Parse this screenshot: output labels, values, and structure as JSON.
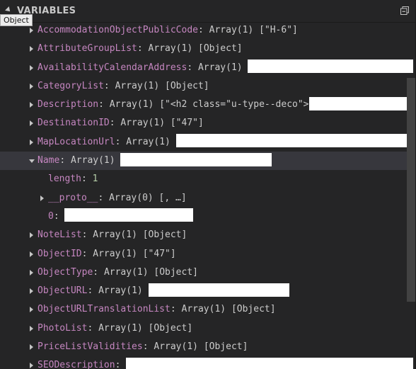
{
  "panel": {
    "title": "VARIABLES",
    "collapse_icon": "collapse-all-icon"
  },
  "tooltip": {
    "text": "Object"
  },
  "tree": {
    "rows": [
      {
        "key": "AccommodationObjectPublicCode",
        "sep": ": ",
        "value": "Array(1) [\"H-6\"]",
        "expandable": true,
        "expanded": false,
        "redacted": false
      },
      {
        "key": "AttributeGroupList",
        "sep": ": ",
        "value": "Array(1) [Object]",
        "expandable": true,
        "expanded": false,
        "redacted": false
      },
      {
        "key": "AvailabilityCalendarAddress",
        "sep": ": ",
        "value": "Array(1) ",
        "expandable": true,
        "expanded": false,
        "redacted": true
      },
      {
        "key": "CategoryList",
        "sep": ": ",
        "value": "Array(1) [Object]",
        "expandable": true,
        "expanded": false,
        "redacted": false
      },
      {
        "key": "Description",
        "sep": ": ",
        "value": "Array(1) [\"<h2 class=\"u-type--deco\">",
        "expandable": true,
        "expanded": false,
        "redacted": true
      },
      {
        "key": "DestinationID",
        "sep": ": ",
        "value": "Array(1) [\"47\"]",
        "expandable": true,
        "expanded": false,
        "redacted": false
      },
      {
        "key": "MapLocationUrl",
        "sep": ": ",
        "value": "Array(1) ",
        "expandable": true,
        "expanded": false,
        "redacted": true
      },
      {
        "key": "Name",
        "sep": ": ",
        "value": "Array(1) ",
        "expandable": true,
        "expanded": true,
        "redacted": true
      },
      {
        "key": "length",
        "sep": ": ",
        "value": "1",
        "expandable": false,
        "child": true,
        "redacted": false
      },
      {
        "key": "__proto__",
        "sep": ": ",
        "value": "Array(0) [, …]",
        "expandable": true,
        "expanded": false,
        "child": true,
        "redacted": false
      },
      {
        "key": "0",
        "sep": ": ",
        "value": "",
        "expandable": false,
        "child": true,
        "redacted": true
      },
      {
        "key": "NoteList",
        "sep": ": ",
        "value": "Array(1) [Object]",
        "expandable": true,
        "expanded": false,
        "redacted": false
      },
      {
        "key": "ObjectID",
        "sep": ": ",
        "value": "Array(1) [\"47\"]",
        "expandable": true,
        "expanded": false,
        "redacted": false
      },
      {
        "key": "ObjectType",
        "sep": ": ",
        "value": "Array(1) [Object]",
        "expandable": true,
        "expanded": false,
        "redacted": false
      },
      {
        "key": "ObjectURL",
        "sep": ": ",
        "value": "Array(1) ",
        "expandable": true,
        "expanded": false,
        "redacted": true
      },
      {
        "key": "ObjectURLTranslationList",
        "sep": ": ",
        "value": "Array(1) [Object]",
        "expandable": true,
        "expanded": false,
        "redacted": false
      },
      {
        "key": "PhotoList",
        "sep": ": ",
        "value": "Array(1) [Object]",
        "expandable": true,
        "expanded": false,
        "redacted": false
      },
      {
        "key": "PriceListValidities",
        "sep": ": ",
        "value": "Array(1) [Object]",
        "expandable": true,
        "expanded": false,
        "redacted": false
      },
      {
        "key": "SEODescription",
        "sep": ": ",
        "value": "",
        "expandable": true,
        "expanded": false,
        "redacted": true
      }
    ]
  },
  "colors": {
    "background": "#252526",
    "key": "#c586c0",
    "value": "#cccccc",
    "number": "#b5cea8",
    "selected_row": "#37373d"
  }
}
